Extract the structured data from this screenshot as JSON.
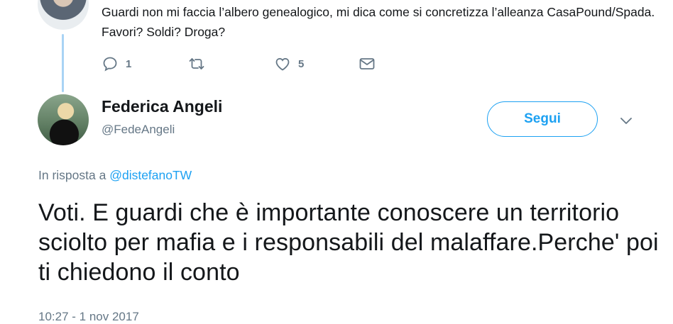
{
  "previous_tweet": {
    "text": "Guardi non mi faccia l’albero genealogico, mi dica come si concretizza l’alleanza CasaPound/Spada. Favori? Soldi? Droga?",
    "actions": {
      "reply_icon": "reply-icon",
      "reply_count": "1",
      "retweet_icon": "retweet-icon",
      "like_icon": "heart-icon",
      "like_count": "5",
      "dm_icon": "envelope-icon"
    }
  },
  "tweet": {
    "author_name": "Federica Angeli",
    "author_handle": "@FedeAngeli",
    "follow_label": "Segui",
    "menu_icon": "chevron-down-icon",
    "reply_prefix": "In risposta a",
    "reply_mention": "@distefanoTW",
    "text": "Voti. E guardi che è importante conoscere un territorio sciolto per mafia e i responsabili del malaffare.Perche' poi ti chiedono il conto",
    "timestamp": "10:27 - 1 nov 2017"
  },
  "colors": {
    "accent": "#1da1f2",
    "secondary_text": "#657786",
    "primary_text": "#14171a",
    "thread_line": "#a9d3f5"
  }
}
